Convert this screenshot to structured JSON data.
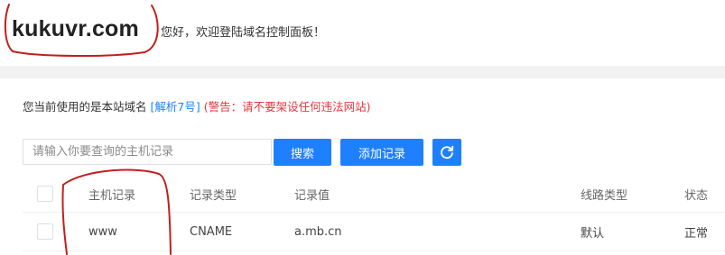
{
  "header": {
    "domain": "kukuvr.com",
    "welcome": "您好，欢迎登陆域名控制面板！"
  },
  "notice": {
    "text": "您当前使用的是本站域名",
    "link": "[解析7号]",
    "warning": "(警告：请不要架设任何违法网站)"
  },
  "toolbar": {
    "search_placeholder": "请输入你要查询的主机记录",
    "search_label": "搜索",
    "add_label": "添加记录",
    "refresh_icon": "refresh-icon"
  },
  "table": {
    "headers": {
      "host": "主机记录",
      "type": "记录类型",
      "value": "记录值",
      "line": "线路类型",
      "status": "状态"
    },
    "rows": [
      {
        "host": "www",
        "type": "CNAME",
        "value": "a.mb.cn",
        "line": "默认",
        "status": "正常"
      }
    ]
  },
  "colors": {
    "accent": "#1e80ff",
    "warning": "#e0383e",
    "annotation": "#c0201d"
  }
}
